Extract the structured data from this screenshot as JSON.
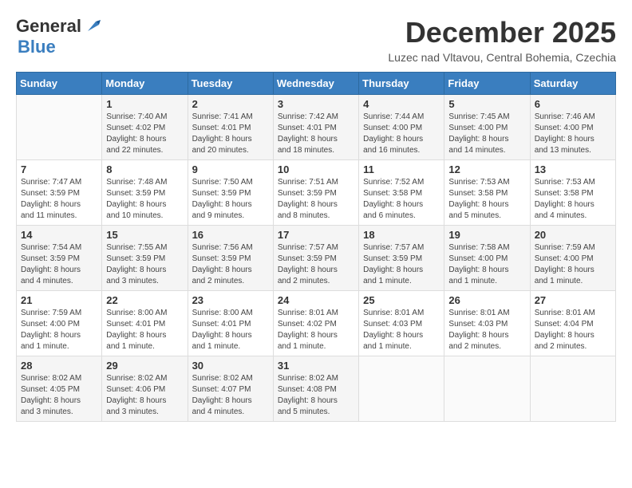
{
  "logo": {
    "general": "General",
    "blue": "Blue"
  },
  "title": {
    "month": "December 2025",
    "location": "Luzec nad Vltavou, Central Bohemia, Czechia"
  },
  "headers": [
    "Sunday",
    "Monday",
    "Tuesday",
    "Wednesday",
    "Thursday",
    "Friday",
    "Saturday"
  ],
  "weeks": [
    [
      {
        "day": "",
        "info": ""
      },
      {
        "day": "1",
        "info": "Sunrise: 7:40 AM\nSunset: 4:02 PM\nDaylight: 8 hours\nand 22 minutes."
      },
      {
        "day": "2",
        "info": "Sunrise: 7:41 AM\nSunset: 4:01 PM\nDaylight: 8 hours\nand 20 minutes."
      },
      {
        "day": "3",
        "info": "Sunrise: 7:42 AM\nSunset: 4:01 PM\nDaylight: 8 hours\nand 18 minutes."
      },
      {
        "day": "4",
        "info": "Sunrise: 7:44 AM\nSunset: 4:00 PM\nDaylight: 8 hours\nand 16 minutes."
      },
      {
        "day": "5",
        "info": "Sunrise: 7:45 AM\nSunset: 4:00 PM\nDaylight: 8 hours\nand 14 minutes."
      },
      {
        "day": "6",
        "info": "Sunrise: 7:46 AM\nSunset: 4:00 PM\nDaylight: 8 hours\nand 13 minutes."
      }
    ],
    [
      {
        "day": "7",
        "info": "Sunrise: 7:47 AM\nSunset: 3:59 PM\nDaylight: 8 hours\nand 11 minutes."
      },
      {
        "day": "8",
        "info": "Sunrise: 7:48 AM\nSunset: 3:59 PM\nDaylight: 8 hours\nand 10 minutes."
      },
      {
        "day": "9",
        "info": "Sunrise: 7:50 AM\nSunset: 3:59 PM\nDaylight: 8 hours\nand 9 minutes."
      },
      {
        "day": "10",
        "info": "Sunrise: 7:51 AM\nSunset: 3:59 PM\nDaylight: 8 hours\nand 8 minutes."
      },
      {
        "day": "11",
        "info": "Sunrise: 7:52 AM\nSunset: 3:58 PM\nDaylight: 8 hours\nand 6 minutes."
      },
      {
        "day": "12",
        "info": "Sunrise: 7:53 AM\nSunset: 3:58 PM\nDaylight: 8 hours\nand 5 minutes."
      },
      {
        "day": "13",
        "info": "Sunrise: 7:53 AM\nSunset: 3:58 PM\nDaylight: 8 hours\nand 4 minutes."
      }
    ],
    [
      {
        "day": "14",
        "info": "Sunrise: 7:54 AM\nSunset: 3:59 PM\nDaylight: 8 hours\nand 4 minutes."
      },
      {
        "day": "15",
        "info": "Sunrise: 7:55 AM\nSunset: 3:59 PM\nDaylight: 8 hours\nand 3 minutes."
      },
      {
        "day": "16",
        "info": "Sunrise: 7:56 AM\nSunset: 3:59 PM\nDaylight: 8 hours\nand 2 minutes."
      },
      {
        "day": "17",
        "info": "Sunrise: 7:57 AM\nSunset: 3:59 PM\nDaylight: 8 hours\nand 2 minutes."
      },
      {
        "day": "18",
        "info": "Sunrise: 7:57 AM\nSunset: 3:59 PM\nDaylight: 8 hours\nand 1 minute."
      },
      {
        "day": "19",
        "info": "Sunrise: 7:58 AM\nSunset: 4:00 PM\nDaylight: 8 hours\nand 1 minute."
      },
      {
        "day": "20",
        "info": "Sunrise: 7:59 AM\nSunset: 4:00 PM\nDaylight: 8 hours\nand 1 minute."
      }
    ],
    [
      {
        "day": "21",
        "info": "Sunrise: 7:59 AM\nSunset: 4:00 PM\nDaylight: 8 hours\nand 1 minute."
      },
      {
        "day": "22",
        "info": "Sunrise: 8:00 AM\nSunset: 4:01 PM\nDaylight: 8 hours\nand 1 minute."
      },
      {
        "day": "23",
        "info": "Sunrise: 8:00 AM\nSunset: 4:01 PM\nDaylight: 8 hours\nand 1 minute."
      },
      {
        "day": "24",
        "info": "Sunrise: 8:01 AM\nSunset: 4:02 PM\nDaylight: 8 hours\nand 1 minute."
      },
      {
        "day": "25",
        "info": "Sunrise: 8:01 AM\nSunset: 4:03 PM\nDaylight: 8 hours\nand 1 minute."
      },
      {
        "day": "26",
        "info": "Sunrise: 8:01 AM\nSunset: 4:03 PM\nDaylight: 8 hours\nand 2 minutes."
      },
      {
        "day": "27",
        "info": "Sunrise: 8:01 AM\nSunset: 4:04 PM\nDaylight: 8 hours\nand 2 minutes."
      }
    ],
    [
      {
        "day": "28",
        "info": "Sunrise: 8:02 AM\nSunset: 4:05 PM\nDaylight: 8 hours\nand 3 minutes."
      },
      {
        "day": "29",
        "info": "Sunrise: 8:02 AM\nSunset: 4:06 PM\nDaylight: 8 hours\nand 3 minutes."
      },
      {
        "day": "30",
        "info": "Sunrise: 8:02 AM\nSunset: 4:07 PM\nDaylight: 8 hours\nand 4 minutes."
      },
      {
        "day": "31",
        "info": "Sunrise: 8:02 AM\nSunset: 4:08 PM\nDaylight: 8 hours\nand 5 minutes."
      },
      {
        "day": "",
        "info": ""
      },
      {
        "day": "",
        "info": ""
      },
      {
        "day": "",
        "info": ""
      }
    ]
  ]
}
